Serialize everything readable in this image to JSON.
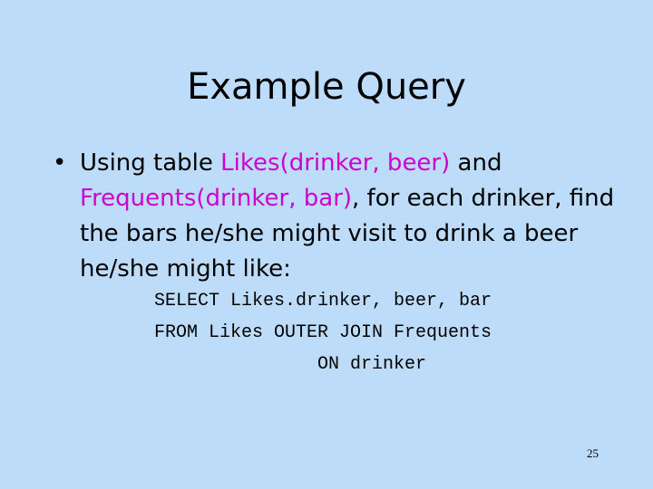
{
  "slide": {
    "title": "Example Query",
    "bullet": {
      "marker": "•",
      "text_1": "Using table ",
      "highlight_1": "Likes(drinker, beer)",
      "text_2": " and ",
      "highlight_2": "Frequents(drinker, bar)",
      "text_3": ", for each drinker, find the bars he/she might visit to drink a beer he/she might like:"
    },
    "code": {
      "line_1": "SELECT Likes.drinker, beer, bar",
      "line_2": "FROM Likes OUTER JOIN Frequents",
      "line_3": "ON drinker"
    },
    "page_number": "25"
  },
  "colors": {
    "background": "#bcdcfa",
    "highlight": "#cc00cc"
  }
}
